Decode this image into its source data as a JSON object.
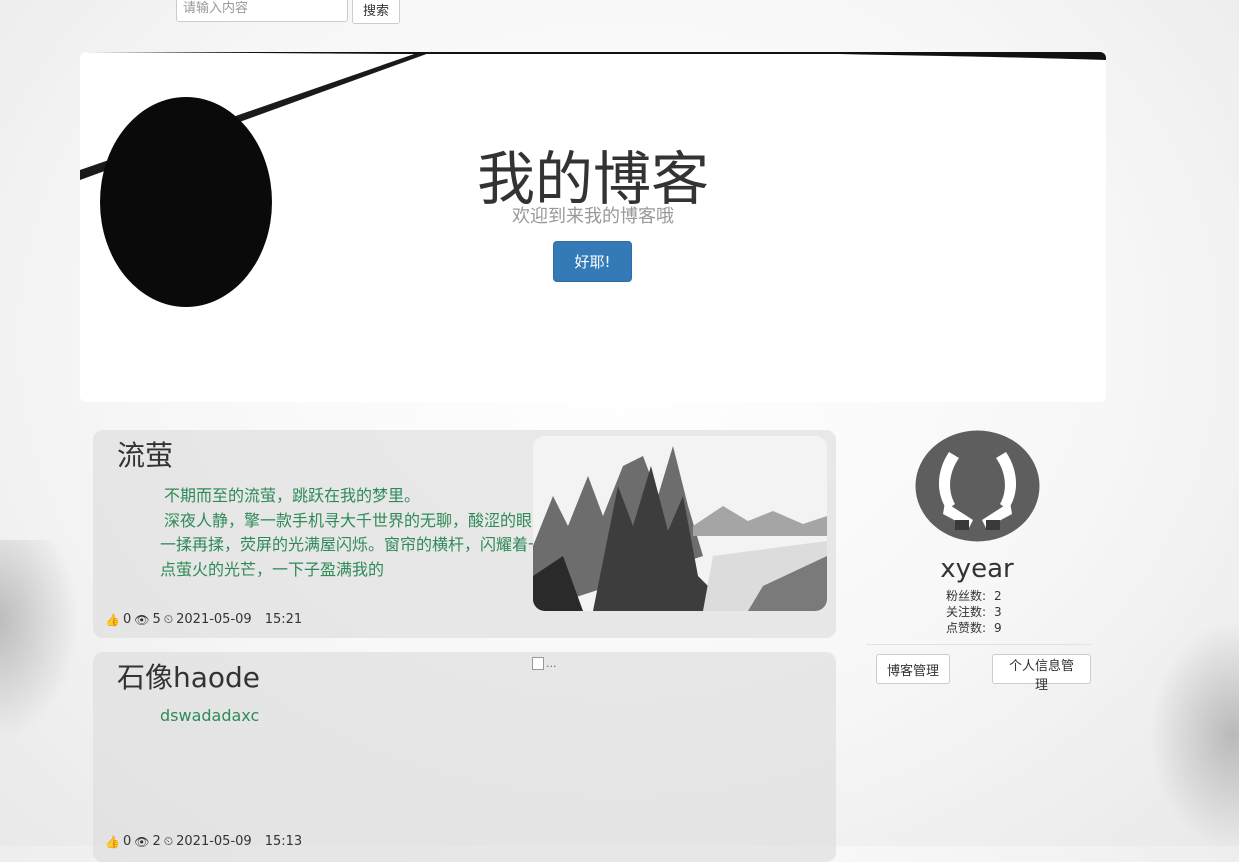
{
  "search": {
    "placeholder": "请输入内容",
    "button_label": "搜索"
  },
  "jumbotron": {
    "title": "我的博客",
    "subtitle": "欢迎到来我的博客哦",
    "button_label": "好耶!"
  },
  "posts": [
    {
      "title": "流萤",
      "body": "不期而至的流萤，跳跃在我的梦里。\n深夜人静，擎一款手机寻大千世界的无聊，酸涩的眼睛一揉再揉，荧屏的光满屋闪烁。窗帘的横杆，闪耀着一点萤火的光芒，一下子盈满我的",
      "likes": "0",
      "views": "5",
      "date": "2021-05-09",
      "time": "15:21",
      "image": "ink-landscape-painting"
    },
    {
      "title": "石像haode",
      "body": "dswadadaxc",
      "likes": "0",
      "views": "2",
      "date": "2021-05-09",
      "time": "15:13",
      "image_alt": "..."
    }
  ],
  "profile": {
    "username": "xyear",
    "stats": [
      {
        "label": "粉丝数:",
        "value": "2"
      },
      {
        "label": "关注数:",
        "value": "3"
      },
      {
        "label": "点赞数:",
        "value": "9"
      }
    ],
    "blog_manage_label": "博客管理",
    "profile_manage_label": "个人信息管理"
  },
  "colors": {
    "primary_button": "#337ab7",
    "post_body_text": "#2e8b57"
  },
  "icons": {
    "like": "thumbs-up-icon",
    "views": "eye-icon",
    "time": "clock-icon"
  }
}
